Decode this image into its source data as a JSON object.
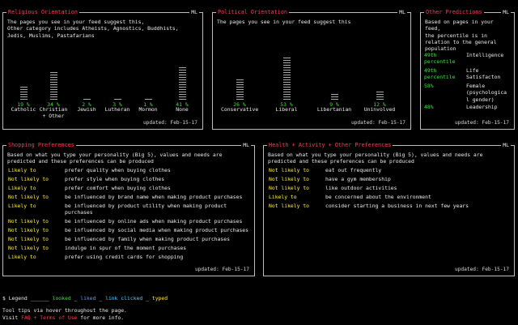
{
  "ml_label": "ML",
  "religious": {
    "title": "Religious Orientation",
    "desc": "The pages you see in your feed suggest this,\nOther category includes Atheists, Agnostics, Buddhists,\nJedis, Muslims, Pastafarians",
    "updated": "updated: Feb-15-17",
    "items": [
      {
        "label": "Catholic",
        "pct": "19 %",
        "value": 19
      },
      {
        "label": "Christian\n+ Other",
        "pct": "34 %",
        "value": 34
      },
      {
        "label": "Jewish",
        "pct": "2 %",
        "value": 2
      },
      {
        "label": "Lutheran",
        "pct": "3 %",
        "value": 3
      },
      {
        "label": "Mormon",
        "pct": "1 %",
        "value": 1
      },
      {
        "label": "None",
        "pct": "41 %",
        "value": 41
      }
    ]
  },
  "political": {
    "title": "Political Orientation",
    "desc": "The pages you see in your feed suggest this",
    "updated": "updated: Feb-15-17",
    "items": [
      {
        "label": "Conservative",
        "pct": "26 %",
        "value": 26
      },
      {
        "label": "Liberal",
        "pct": "53 %",
        "value": 53
      },
      {
        "label": "Libertanian",
        "pct": "9 %",
        "value": 9
      },
      {
        "label": "Uninvolved",
        "pct": "12 %",
        "value": 12
      }
    ]
  },
  "other": {
    "title": "Other Predictions",
    "desc": "Based on pages in your feed,\nthe percentile is in relation to the general population",
    "updated": "updated: Feb-15-17",
    "items": [
      {
        "value": "49th\npercentile",
        "label": "Intelligence"
      },
      {
        "value": "49th\npercentile",
        "label": "Life\nSatisfacton"
      },
      {
        "value": "58%",
        "label": "Female\n(psychologica\nl gender)"
      },
      {
        "value": "48%",
        "label": "Leadership"
      }
    ]
  },
  "shopping": {
    "title": "Shopping Preferences",
    "desc": "Based on what you type your personality (Big 5), values and needs are\npredicted and these preferences can be produced",
    "updated": "updated: Feb-15-17",
    "rows": [
      {
        "likely": "Likely to",
        "text": "prefer quality when buying clothes"
      },
      {
        "likely": "Not likely to",
        "text": "prefer style when buying clothes"
      },
      {
        "likely": "Likely to",
        "text": "prefer comfort when buying clothes"
      },
      {
        "likely": "Not likely to",
        "text": "be influenced by brand name when making product purchases"
      },
      {
        "likely": "Likely to",
        "text": "be influenced by product utility when making product\npurchases"
      },
      {
        "likely": "Not likely to",
        "text": "be influenced by online ads when making product purchases"
      },
      {
        "likely": "Not likely to",
        "text": "be influenced by social media when making product purchases"
      },
      {
        "likely": "Not likely to",
        "text": "be influenced by family when making product purchases"
      },
      {
        "likely": "Not likely to",
        "text": "indulge in spur of the moment purchases"
      },
      {
        "likely": "Likely to",
        "text": "prefer using credit cards for shopping"
      }
    ]
  },
  "health": {
    "title": "Health + Activity + Other Preferences",
    "desc": "Based on what you type your personality (Big 5), values and needs are\npredicted and these preferences can be produced",
    "updated": "updated: Feb-15-17",
    "rows": [
      {
        "likely": "Not likely to",
        "text": "eat out frequently"
      },
      {
        "likely": "Not likely to",
        "text": "have a gym membership"
      },
      {
        "likely": "Not likely to",
        "text": "like outdoor activities"
      },
      {
        "likely": "Likely to",
        "text": "be concerned about the environment"
      },
      {
        "likely": "Not likely to",
        "text": "consider starting a business in next few years"
      }
    ]
  },
  "legend": {
    "prefix": "$ Legend",
    "looked": "looked",
    "liked": "liked",
    "link_clicked": "link clicked",
    "typed": "typed"
  },
  "footer": {
    "line1": "Tool tips via hover throughout the page.",
    "visit": "Visit",
    "faq": "FAQ",
    "plus": "+",
    "terms": "Terms of Use",
    "more": "for more info."
  },
  "colors": {
    "title_red": "#ff3b55",
    "percent_green": "#43e043",
    "likely_yellow": "#ffee3a",
    "liked_blue": "#4aa0ff",
    "link_cyan": "#4ed0ff"
  }
}
